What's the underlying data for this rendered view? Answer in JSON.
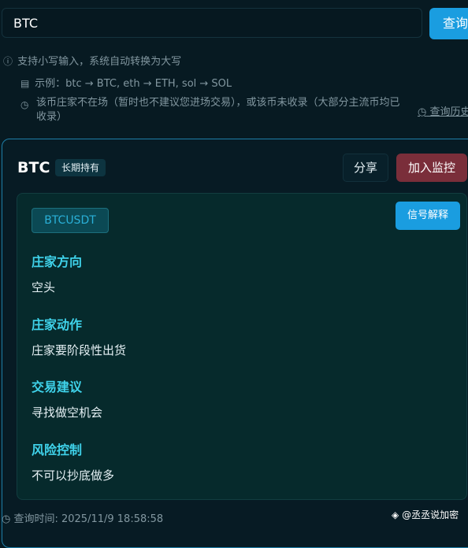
{
  "search": {
    "value": "BTC",
    "button_label": "查询"
  },
  "hints": {
    "line1": "支持小写输入，系统自动转换为大写",
    "line2": "示例：btc → BTC, eth → ETH, sol → SOL",
    "line3": "该币庄家不在场（暂时也不建议您进场交易），或该币未收录（大部分主流币均已收录）",
    "history_link": "查询历史"
  },
  "card": {
    "title": "BTC",
    "tag": "长期持有",
    "share_label": "分享",
    "monitor_label": "加入监控",
    "symbol": "BTCUSDT",
    "explain_label": "信号解释",
    "sections": [
      {
        "title": "庄家方向",
        "value": "空头"
      },
      {
        "title": "庄家动作",
        "value": "庄家要阶段性出货"
      },
      {
        "title": "交易建议",
        "value": "寻找做空机会"
      },
      {
        "title": "风险控制",
        "value": "不可以抄底做多"
      }
    ]
  },
  "footer": {
    "query_time": "查询时间: 2025/11/9 18:58:58",
    "watermark": "@丞丞说加密"
  },
  "colors": {
    "background": "#071a22",
    "accent_blue": "#1a9de0",
    "monitor_red": "#7a2e3a",
    "section_cyan": "#3fd2ea"
  },
  "icons": [
    "info-icon",
    "file-icon",
    "clock-icon",
    "history-clock-icon",
    "logo-icon"
  ]
}
